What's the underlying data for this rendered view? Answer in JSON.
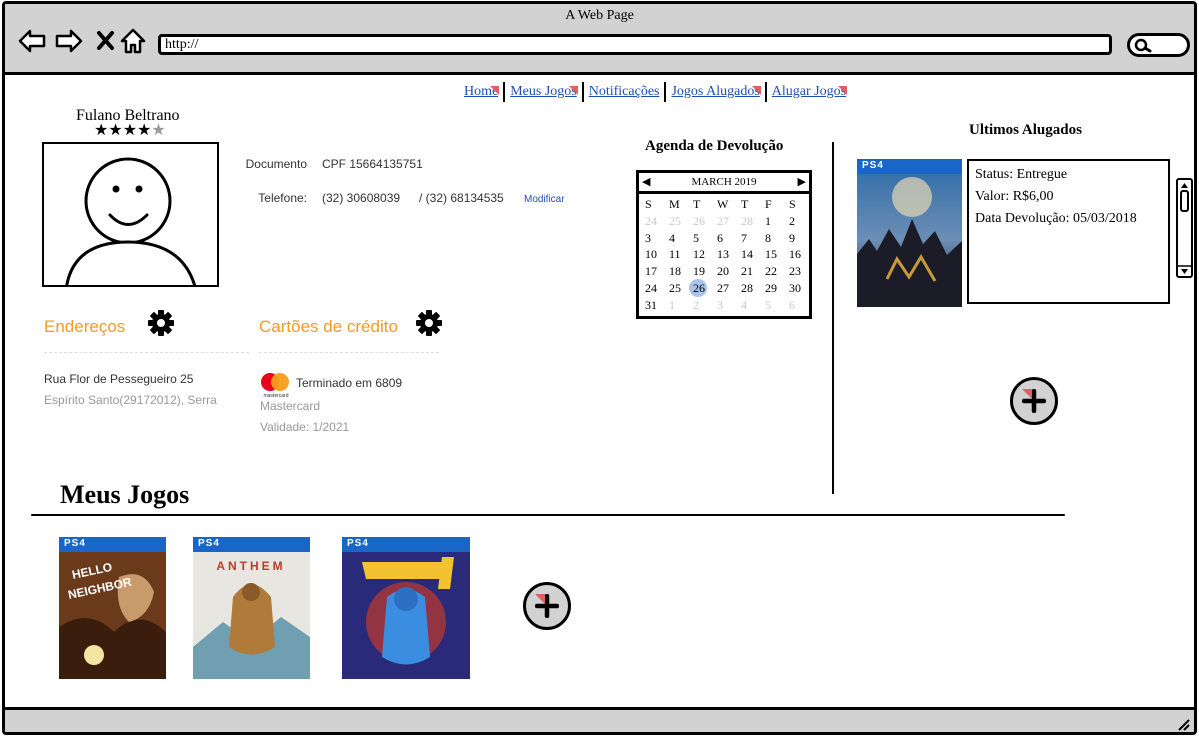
{
  "window": {
    "title": "A Web Page",
    "url": "http://"
  },
  "nav": {
    "links": [
      {
        "label": "Home"
      },
      {
        "label": "Meus Jogos"
      },
      {
        "label": "Notificações"
      },
      {
        "label": "Jogos Alugados"
      },
      {
        "label": "Alugar Jogos"
      }
    ]
  },
  "profile": {
    "name": "Fulano Beltrano",
    "rating": 4,
    "rating_max": 5,
    "star_glyph": "★",
    "document_label": "Documento",
    "document_value": "CPF 15664135751",
    "phone_label": "Telefone:",
    "phone_1": "(32) 30608039",
    "phone_2": "/ (32) 68134535",
    "modify_label": "Modificar"
  },
  "addresses": {
    "title": "Endereços",
    "line1": "Rua Flor de Pessegueiro 25",
    "line2": "Espírito Santo(29172012), Serra"
  },
  "cards": {
    "title": "Cartões de crédito",
    "ending": "Terminado em 6809",
    "brand": "Mastercard",
    "brand_logo_text": "mastercard",
    "validity": "Validade: 1/2021"
  },
  "calendar": {
    "title": "Agenda de Devolução",
    "month": "MARCH 2019",
    "prev": "◀",
    "next": "▶",
    "weekdays": [
      "S",
      "M",
      "T",
      "W",
      "T",
      "F",
      "S"
    ],
    "days": [
      {
        "d": "24",
        "o": true
      },
      {
        "d": "25",
        "o": true
      },
      {
        "d": "26",
        "o": true
      },
      {
        "d": "27",
        "o": true
      },
      {
        "d": "28",
        "o": true
      },
      {
        "d": "1"
      },
      {
        "d": "2"
      },
      {
        "d": "3"
      },
      {
        "d": "4"
      },
      {
        "d": "5"
      },
      {
        "d": "6"
      },
      {
        "d": "7"
      },
      {
        "d": "8"
      },
      {
        "d": "9"
      },
      {
        "d": "10"
      },
      {
        "d": "11"
      },
      {
        "d": "12"
      },
      {
        "d": "13"
      },
      {
        "d": "14"
      },
      {
        "d": "15"
      },
      {
        "d": "16"
      },
      {
        "d": "17"
      },
      {
        "d": "18"
      },
      {
        "d": "19"
      },
      {
        "d": "20"
      },
      {
        "d": "21"
      },
      {
        "d": "22"
      },
      {
        "d": "23"
      },
      {
        "d": "24"
      },
      {
        "d": "25"
      },
      {
        "d": "26",
        "sel": true
      },
      {
        "d": "27"
      },
      {
        "d": "28"
      },
      {
        "d": "29"
      },
      {
        "d": "30"
      },
      {
        "d": "31"
      },
      {
        "d": "1",
        "o": true
      },
      {
        "d": "2",
        "o": true
      },
      {
        "d": "3",
        "o": true
      },
      {
        "d": "4",
        "o": true
      },
      {
        "d": "5",
        "o": true
      },
      {
        "d": "6",
        "o": true
      }
    ]
  },
  "last_rented": {
    "title": "Ultimos Alugados",
    "cover_badge": "PS4",
    "status": "Status: Entregue",
    "value": "Valor: R$6,00",
    "return_date": "Data Devolução: 05/03/2018"
  },
  "my_games": {
    "title": "Meus Jogos",
    "cover_badge": "PS4",
    "anthem_logo": "ANTHEM",
    "cover_colors": [
      "#6b3a1a",
      "#6f9fb0",
      "#2a2a7a"
    ]
  },
  "colors": {
    "accent": "#f59a23",
    "link": "#1f4fb4",
    "chrome": "#d2d2d2",
    "ps4": "#1866c8"
  }
}
